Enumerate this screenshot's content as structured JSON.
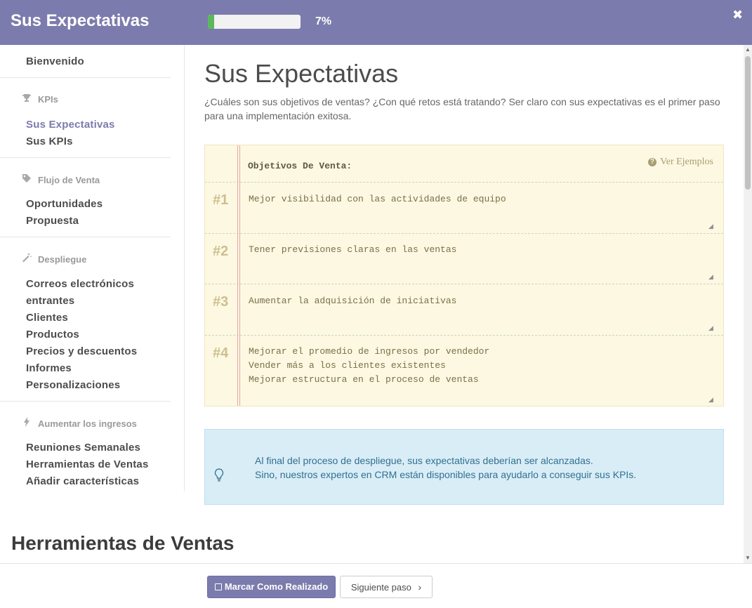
{
  "header": {
    "title": "Sus Expectativas",
    "progress_percent": 7,
    "progress_label": "7%",
    "close_icon": "close-icon",
    "colors": {
      "bar": "#7c7bad",
      "progress": "#5cb85c"
    }
  },
  "sidebar": {
    "welcome": "Bienvenido",
    "sections": [
      {
        "category": "KPIs",
        "icon": "trophy-icon",
        "items": [
          "Sus Expectativas",
          "Sus KPIs"
        ]
      },
      {
        "category": "Flujo de Venta",
        "icon": "tag-icon",
        "items": [
          "Oportunidades",
          "Propuesta"
        ]
      },
      {
        "category": "Despliegue",
        "icon": "magic-wand-icon",
        "items": [
          "Correos electrónicos",
          "entrantes",
          "Clientes",
          "Productos",
          "Precios y descuentos",
          "Informes",
          "Personalizaciones"
        ]
      },
      {
        "category": "Aumentar los ingresos",
        "icon": "bolt-icon",
        "items": [
          "Reuniones Semanales",
          "Herramientas de Ventas",
          "Añadir características"
        ]
      }
    ],
    "active_item": "Sus Expectativas"
  },
  "main": {
    "title": "Sus Expectativas",
    "description": "¿Cuáles son sus objetivos de ventas? ¿Con qué retos está tratando? Ser claro con sus expectativas es el primer paso para una implementación exitosa.",
    "pad": {
      "heading": "Objetivos De Venta:",
      "examples_link": "Ver Ejemplos",
      "goals": [
        {
          "number": "#1",
          "text": "Mejor visibilidad con las actividades de equipo"
        },
        {
          "number": "#2",
          "text": "Tener previsiones claras en las ventas"
        },
        {
          "number": "#3",
          "text": "Aumentar la adquisición de iniciativas"
        },
        {
          "number": "#4",
          "text": "Mejorar el promedio de ingresos por vendedor\nVender más a los clientes existentes\nMejorar estructura en el proceso de ventas"
        }
      ]
    },
    "info": {
      "icon": "lightbulb-icon",
      "line1": "Al final del proceso de despliegue, sus expectativas deberían ser alcanzadas.",
      "line2": "Sino, nuestros expertos en CRM están disponibles para ayudarlo a conseguir sus KPIs."
    },
    "next_section_title": "Herramientas de Ventas"
  },
  "footer": {
    "mark_done": "Marcar Como Realizado",
    "next_step": "Siguiente paso",
    "next_icon": "chevron-right-icon"
  }
}
